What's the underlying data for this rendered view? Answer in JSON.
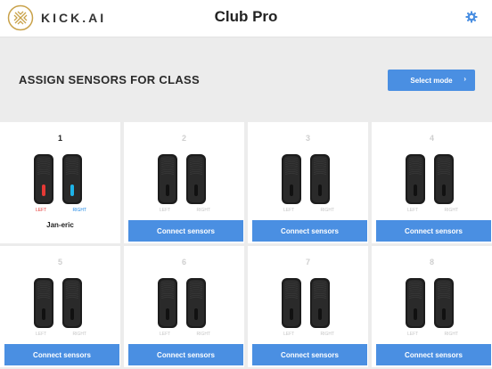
{
  "header": {
    "logo_text": "KICK.AI",
    "title": "Club Pro"
  },
  "banner": {
    "title": "ASSIGN SENSORS FOR CLASS",
    "select_mode_label": "Select mode"
  },
  "sensor_labels": {
    "left": "LEFT",
    "right": "RIGHT"
  },
  "connect_label": "Connect sensors",
  "colors": {
    "accent": "#4a8fe2",
    "left_indicator": "#e53935",
    "right_indicator": "#1eb3e8"
  },
  "slots": [
    {
      "number": "1",
      "assigned": true,
      "name": "Jan-eric"
    },
    {
      "number": "2",
      "assigned": false
    },
    {
      "number": "3",
      "assigned": false
    },
    {
      "number": "4",
      "assigned": false
    },
    {
      "number": "5",
      "assigned": false
    },
    {
      "number": "6",
      "assigned": false
    },
    {
      "number": "7",
      "assigned": false
    },
    {
      "number": "8",
      "assigned": false
    }
  ]
}
